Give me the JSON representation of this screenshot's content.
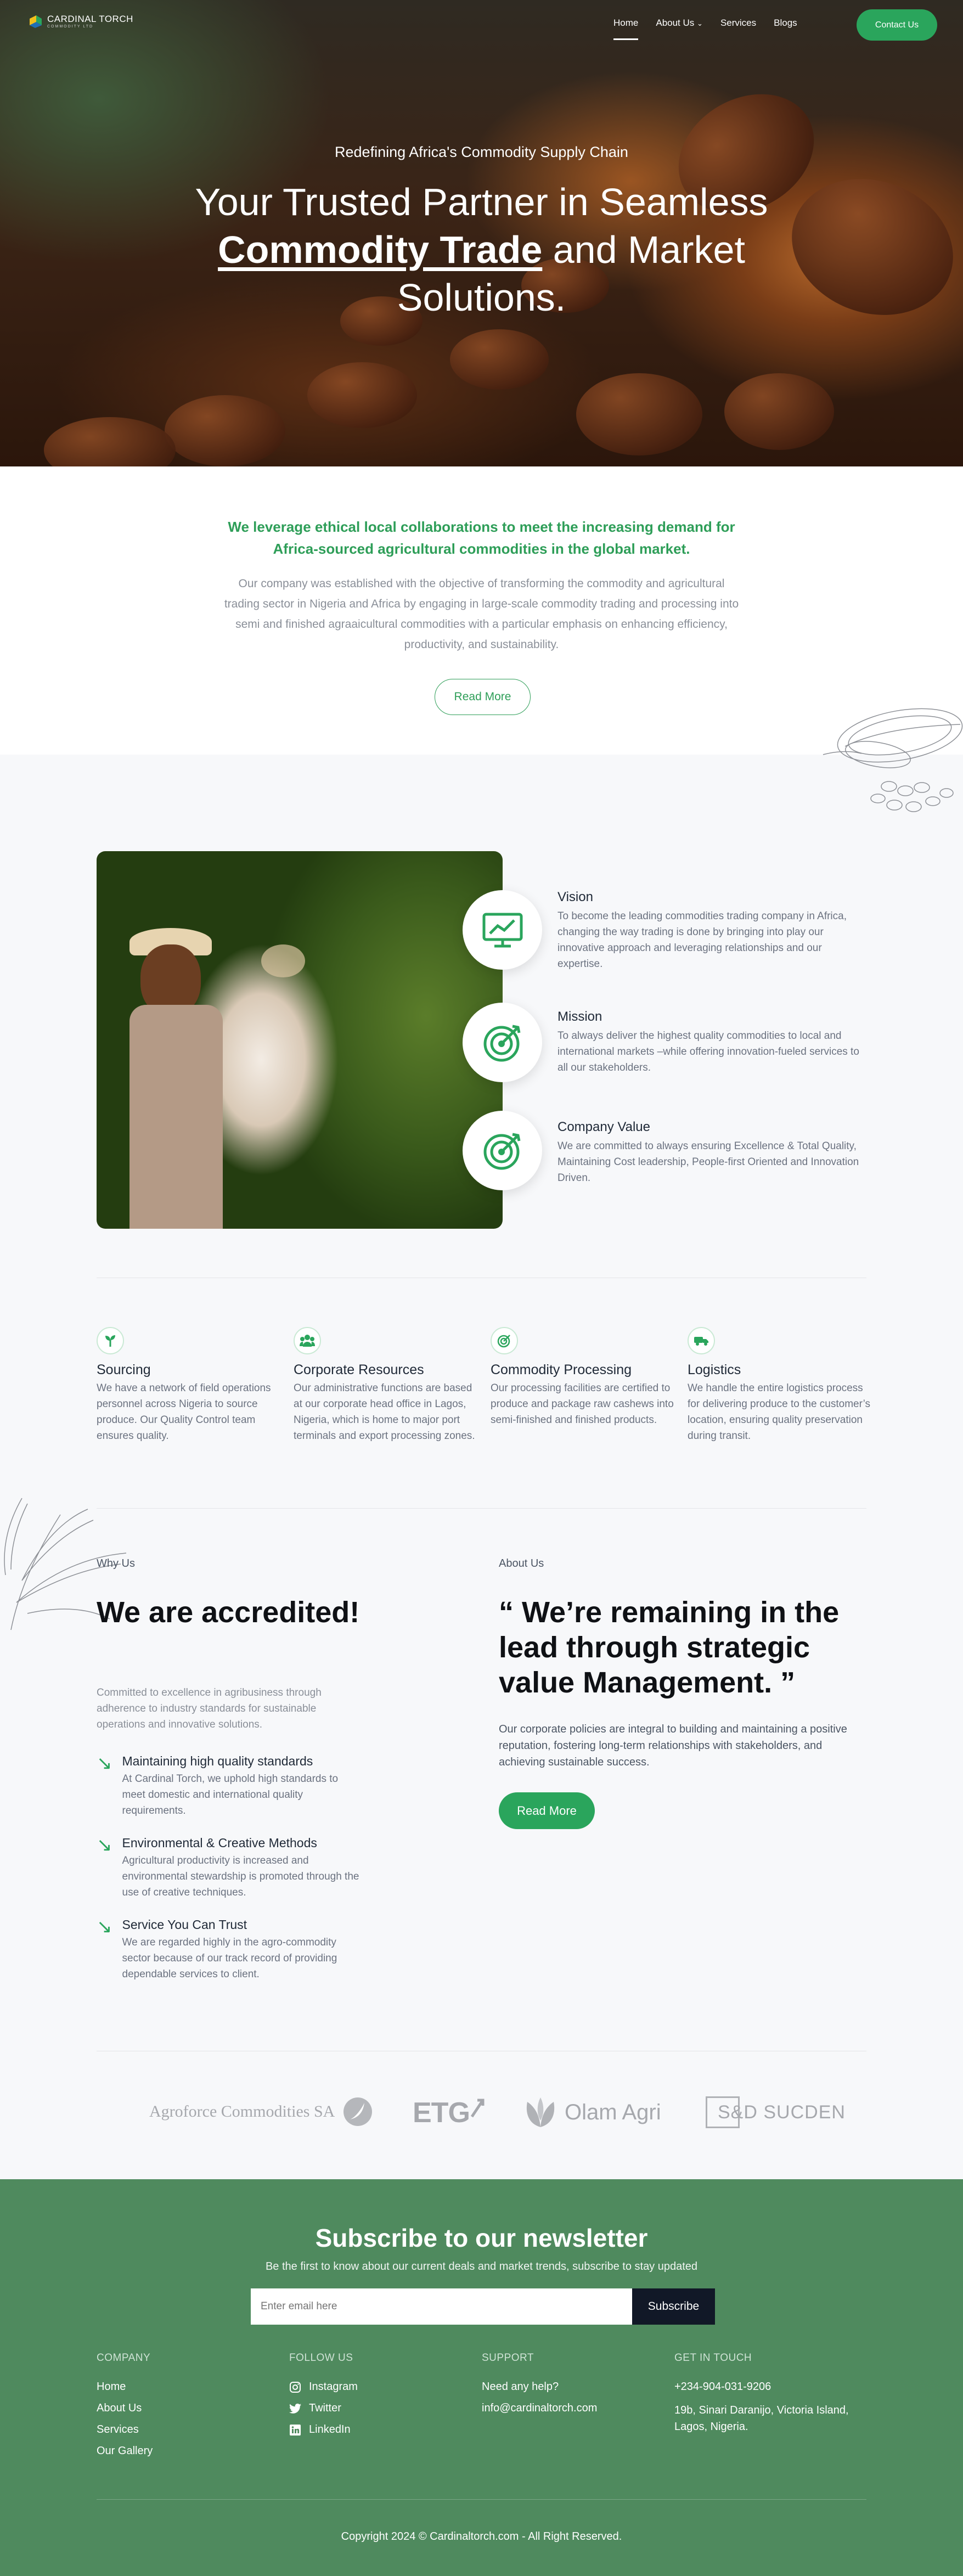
{
  "brand": {
    "name": "CARDINAL TORCH",
    "tagline": "COMMODITY LTD",
    "accent": "#2aa55c"
  },
  "nav": {
    "items": [
      "Home",
      "About Us",
      "Services",
      "Blogs"
    ],
    "contact_label": "Contact Us"
  },
  "hero": {
    "tagline": "Redefining Africa's Commodity Supply Chain",
    "title_pre": "Your Trusted Partner in Seamless",
    "title_bold": "Commodity Trade",
    "title_post": "and Market Solutions."
  },
  "intro": {
    "lead": "We leverage ethical local collaborations to meet the increasing demand for Africa-sourced agricultural commodities in the global market.",
    "body": "Our company was established with the objective of transforming the commodity and agricultural trading sector in Nigeria and Africa by engaging in large-scale commodity trading and processing into semi and finished agraaicultural commodities with a particular emphasis on enhancing efficiency, productivity, and sustainability.",
    "button": "Read More"
  },
  "pillars": [
    {
      "title": "Vision",
      "icon": "chart-icon",
      "text": "To become the leading commodities trading company in Africa, changing the way trading is done by bringing into play our innovative approach and leveraging relationships and our expertise."
    },
    {
      "title": "Mission",
      "icon": "target-icon",
      "text": "To always deliver the highest quality commodities to local and international markets –while offering innovation-fueled services to all our stakeholders."
    },
    {
      "title": "Company Value",
      "icon": "target-icon",
      "text": "We are committed to always ensuring Excellence & Total Quality, Maintaining Cost leadership, People-first Oriented and Innovation Driven."
    }
  ],
  "features": [
    {
      "title": "Sourcing",
      "icon": "sprout-icon",
      "text": "We have a network of field operations personnel across Nigeria to source produce. Our Quality Control team ensures quality."
    },
    {
      "title": "Corporate Resources",
      "icon": "team-icon",
      "text": "Our administrative functions are based at our corporate head office in Lagos, Nigeria, which is home to major port terminals and export processing zones."
    },
    {
      "title": "Commodity Processing",
      "icon": "target-icon",
      "text": "Our processing facilities are certified to produce and package raw cashews into semi-finished and finished products."
    },
    {
      "title": "Logistics",
      "icon": "truck-icon",
      "text": "We handle the entire logistics process for delivering produce to the customer’s location, ensuring quality preservation during transit."
    }
  ],
  "why": {
    "label": "Why Us",
    "heading": "We are accredited!",
    "intro": "Committed to excellence in agribusiness through adherence to industry standards for sustainable operations and innovative solutions.",
    "items": [
      {
        "title": "Maintaining high quality standards",
        "text": "At Cardinal Torch, we uphold high standards to meet domestic and international quality requirements."
      },
      {
        "title": "Environmental & Creative Methods",
        "text": "Agricultural productivity is increased and environmental stewardship is promoted through the use of creative techniques."
      },
      {
        "title": "Service You Can Trust",
        "text": "We are regarded highly in the agro-commodity sector because of our track record of providing dependable services to client."
      }
    ]
  },
  "about": {
    "label": "About Us",
    "quote": "“ We’re remaining in the lead through strategic value Management. ”",
    "text": "Our corporate policies are integral to building and maintaining a positive reputation, fostering long-term relationships with stakeholders, and achieving sustainable success.",
    "button": "Read More"
  },
  "partners": [
    "Agroforce Commodities SA",
    "ETG",
    "Olam Agri",
    "S&D SUCDEN"
  ],
  "newsletter": {
    "title": "Subscribe to our newsletter",
    "subtitle": "Be the first to know about our current deals and market trends, subscribe to stay updated",
    "placeholder": "Enter email here",
    "button": "Subscribe"
  },
  "footer": {
    "company": {
      "heading": "COMPANY",
      "links": [
        "Home",
        "About Us",
        "Services",
        "Our Gallery"
      ]
    },
    "follow": {
      "heading": "FOLLOW US",
      "links": [
        "Instagram",
        "Twitter",
        "LinkedIn"
      ]
    },
    "support": {
      "heading": "SUPPORT",
      "links": [
        "Need any help?",
        "info@cardinaltorch.com"
      ]
    },
    "touch": {
      "heading": "GET IN TOUCH",
      "phone": "+234-904-031-9206",
      "address": "19b, Sinari Daranijo, Victoria Island, Lagos, Nigeria."
    },
    "copyright": "Copyright 2024 © Cardinaltorch.com - All Right Reserved."
  }
}
